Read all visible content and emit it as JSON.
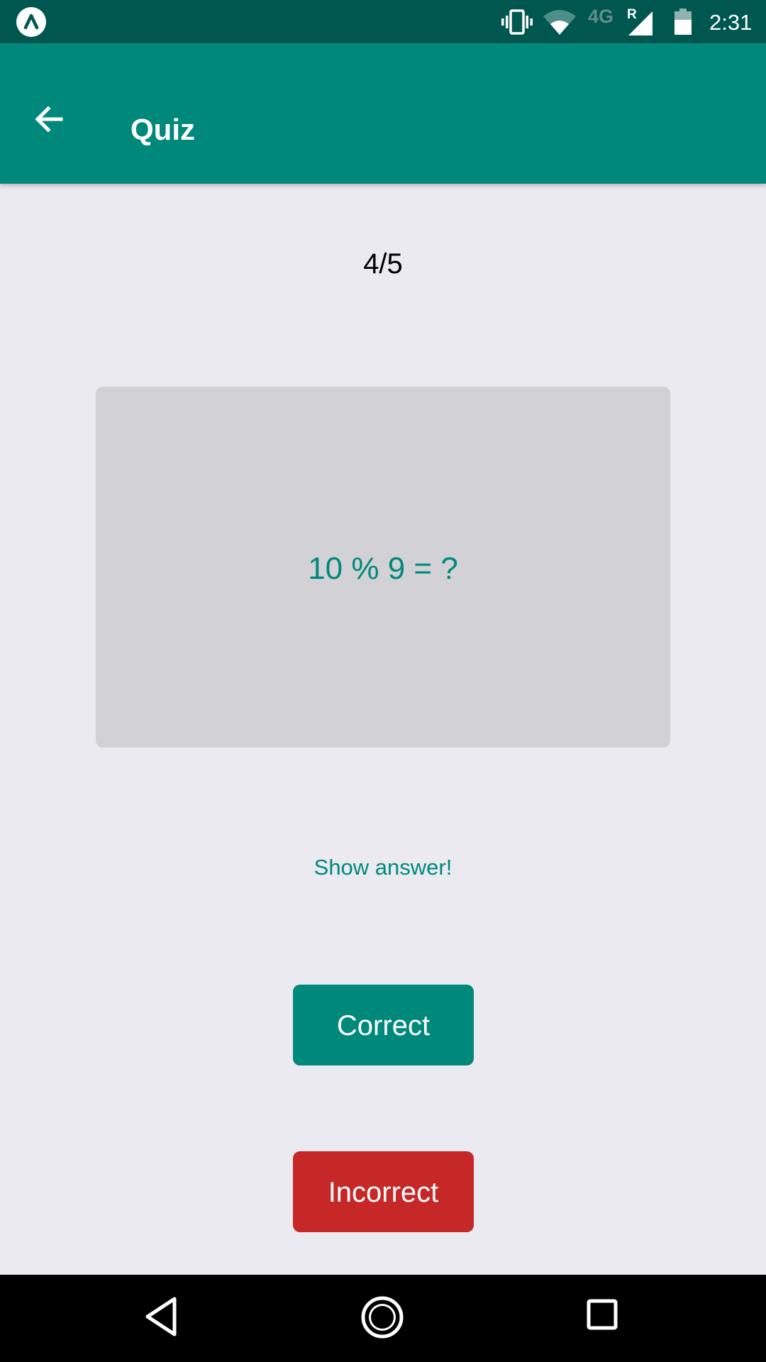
{
  "status_bar": {
    "network_type": "4G",
    "roaming_indicator": "R",
    "time": "2:31",
    "icons": [
      "app-notification-icon",
      "vibrate-icon",
      "wifi-icon",
      "signal-icon",
      "battery-icon"
    ]
  },
  "app_bar": {
    "title": "Quiz",
    "back_icon": "arrow-left-icon",
    "background_color": "#00897B"
  },
  "quiz": {
    "progress": "4/5",
    "question": "10 % 9 = ?",
    "show_answer_label": "Show answer!",
    "correct_label": "Correct",
    "incorrect_label": "Incorrect",
    "accent_color": "#00897B",
    "correct_color": "#00897B",
    "incorrect_color": "#C62828"
  },
  "nav_bar": {
    "icons": [
      "back-triangle-icon",
      "home-circle-icon",
      "recents-square-icon"
    ]
  }
}
